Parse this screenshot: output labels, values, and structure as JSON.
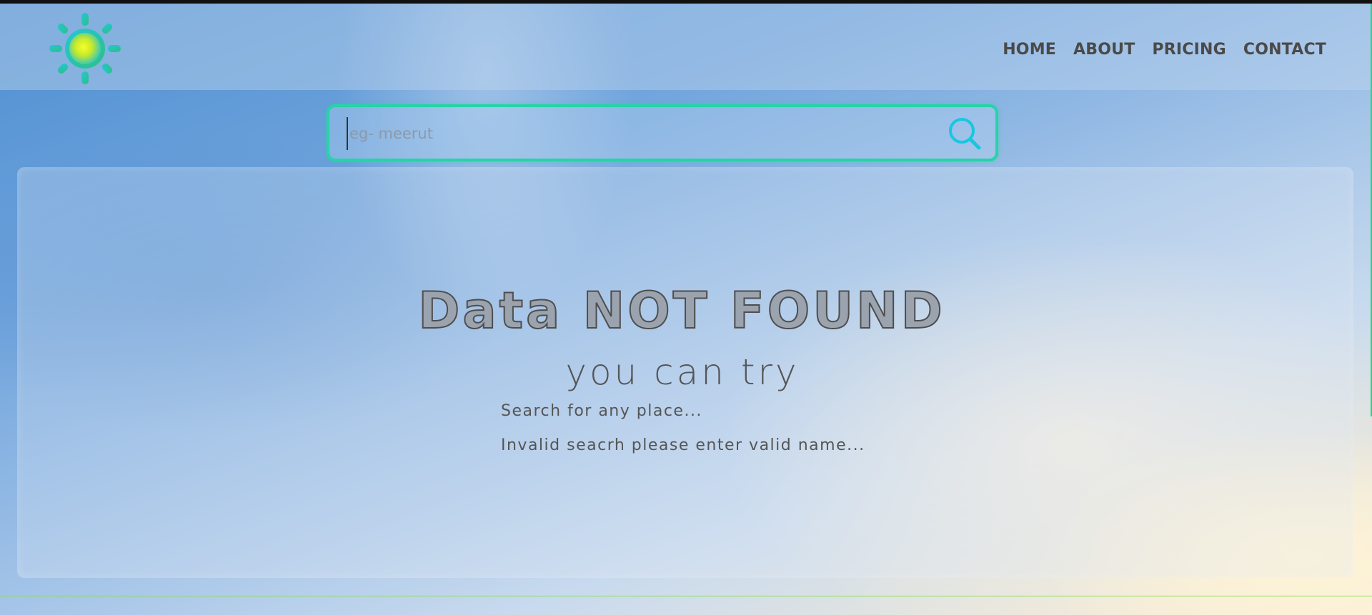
{
  "header": {
    "logo_icon": "sun-icon",
    "nav": [
      {
        "label": "HOME"
      },
      {
        "label": "ABOUT"
      },
      {
        "label": "PRICING"
      },
      {
        "label": "CONTACT"
      }
    ]
  },
  "search": {
    "placeholder": "eg- meerut",
    "value": "",
    "icon": "search-icon"
  },
  "result": {
    "title": "Data NOT FOUND",
    "subtitle": "you can try",
    "tips": [
      "Search for any place...",
      "Invalid seacrh please enter valid name..."
    ]
  },
  "colors": {
    "accent": "#27d3a8",
    "search_icon": "#16c7e0",
    "text": "#4a4a4a"
  }
}
